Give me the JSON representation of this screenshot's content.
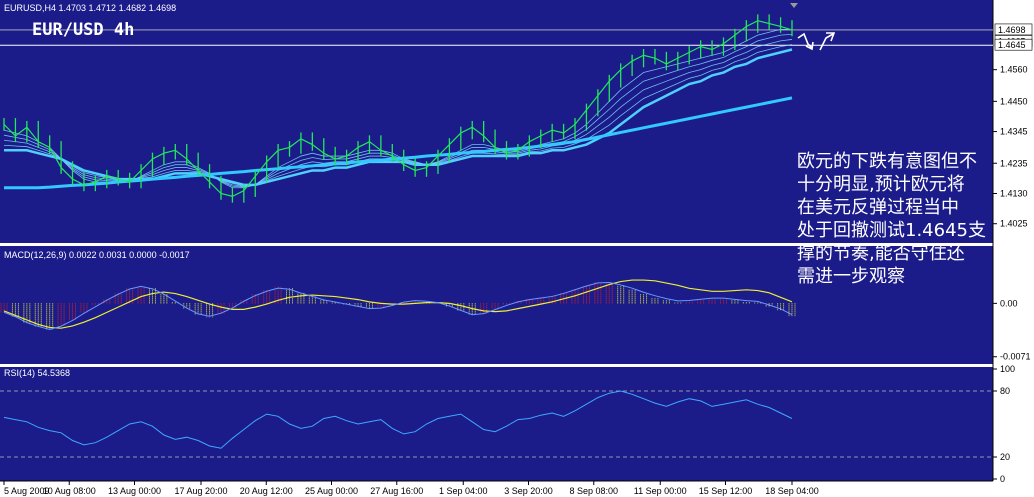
{
  "chart_data": [
    {
      "type": "line",
      "header": "EURUSD,H4  1.4703 1.4712 1.4682 1.4698",
      "title": "EUR/USD  4h",
      "ylim": [
        1.3965,
        1.4795
      ],
      "yticks": [
        "1.4560",
        "1.4450",
        "1.4345",
        "1.4235",
        "1.4130",
        "1.4025"
      ],
      "ytick_values": [
        1.456,
        1.445,
        1.4345,
        1.4235,
        1.413,
        1.4025
      ],
      "price_labels": [
        "1.4698",
        "1.4665",
        "1.4645"
      ],
      "price_label_values": [
        1.4698,
        1.4665,
        1.4645
      ],
      "support_level": 1.4645,
      "price": [
        1.437,
        1.433,
        1.436,
        1.431,
        1.429,
        1.422,
        1.418,
        1.416,
        1.417,
        1.419,
        1.418,
        1.417,
        1.421,
        1.425,
        1.427,
        1.428,
        1.425,
        1.421,
        1.417,
        1.413,
        1.412,
        1.414,
        1.419,
        1.424,
        1.428,
        1.429,
        1.432,
        1.43,
        1.427,
        1.425,
        1.426,
        1.429,
        1.431,
        1.428,
        1.426,
        1.423,
        1.421,
        1.422,
        1.426,
        1.43,
        1.434,
        1.436,
        1.433,
        1.429,
        1.427,
        1.428,
        1.431,
        1.433,
        1.435,
        1.434,
        1.437,
        1.442,
        1.447,
        1.452,
        1.456,
        1.459,
        1.461,
        1.46,
        1.458,
        1.46,
        1.462,
        1.464,
        1.463,
        1.465,
        1.468,
        1.471,
        1.473,
        1.472,
        1.471,
        1.4698
      ],
      "ma_fast": [
        1.435,
        1.434,
        1.433,
        1.431,
        1.429,
        1.425,
        1.421,
        1.418,
        1.417,
        1.417,
        1.417,
        1.417,
        1.419,
        1.421,
        1.423,
        1.424,
        1.424,
        1.422,
        1.42,
        1.417,
        1.415,
        1.415,
        1.416,
        1.419,
        1.422,
        1.424,
        1.426,
        1.427,
        1.426,
        1.426,
        1.426,
        1.427,
        1.428,
        1.428,
        1.427,
        1.425,
        1.424,
        1.423,
        1.424,
        1.426,
        1.428,
        1.43,
        1.43,
        1.429,
        1.428,
        1.428,
        1.429,
        1.43,
        1.431,
        1.432,
        1.434,
        1.437,
        1.441,
        1.445,
        1.449,
        1.452,
        1.455,
        1.456,
        1.457,
        1.458,
        1.459,
        1.46,
        1.461,
        1.462,
        1.464,
        1.466,
        1.468,
        1.469,
        1.47,
        1.47
      ],
      "ma_mid": [
        1.428,
        1.428,
        1.428,
        1.427,
        1.426,
        1.425,
        1.423,
        1.421,
        1.42,
        1.419,
        1.418,
        1.418,
        1.418,
        1.418,
        1.419,
        1.42,
        1.42,
        1.42,
        1.419,
        1.418,
        1.417,
        1.416,
        1.416,
        1.417,
        1.418,
        1.419,
        1.42,
        1.421,
        1.421,
        1.422,
        1.422,
        1.423,
        1.424,
        1.424,
        1.424,
        1.424,
        1.423,
        1.423,
        1.423,
        1.424,
        1.425,
        1.426,
        1.426,
        1.426,
        1.426,
        1.426,
        1.427,
        1.427,
        1.428,
        1.428,
        1.429,
        1.43,
        1.432,
        1.434,
        1.437,
        1.44,
        1.443,
        1.445,
        1.447,
        1.449,
        1.451,
        1.452,
        1.454,
        1.455,
        1.457,
        1.458,
        1.46,
        1.461,
        1.462,
        1.463
      ],
      "ma_slow": [
        1.415,
        1.415,
        1.415,
        1.415,
        1.4152,
        1.4155,
        1.4158,
        1.416,
        1.4163,
        1.4166,
        1.417,
        1.4173,
        1.4176,
        1.418,
        1.4183,
        1.4186,
        1.419,
        1.4193,
        1.4196,
        1.42,
        1.4203,
        1.4206,
        1.421,
        1.4213,
        1.4216,
        1.422,
        1.4223,
        1.4226,
        1.423,
        1.4233,
        1.4236,
        1.424,
        1.4243,
        1.4246,
        1.425,
        1.4253,
        1.4256,
        1.426,
        1.4263,
        1.4266,
        1.427,
        1.4273,
        1.4276,
        1.428,
        1.4283,
        1.4286,
        1.429,
        1.4295,
        1.43,
        1.4305,
        1.431,
        1.4318,
        1.4326,
        1.4334,
        1.4342,
        1.435,
        1.4358,
        1.4366,
        1.4374,
        1.4382,
        1.439,
        1.4398,
        1.4406,
        1.4414,
        1.4422,
        1.443,
        1.4438,
        1.4446,
        1.4454,
        1.4462
      ]
    },
    {
      "type": "bar",
      "header": "MACD(12,26,9) 0.0022 0.0031 0.0000 -0.0017",
      "ylim": [
        -0.0078,
        0.0055
      ],
      "yticks": [
        "0.00",
        "-0.0071"
      ],
      "ytick_values": [
        0,
        -0.0071
      ],
      "values": [
        -0.0012,
        -0.0018,
        -0.0026,
        -0.0031,
        -0.0035,
        -0.003,
        -0.0022,
        -0.0012,
        -0.0003,
        0.0006,
        0.0014,
        0.0021,
        0.0024,
        0.002,
        0.0012,
        0.0002,
        -0.0008,
        -0.0016,
        -0.0019,
        -0.0014,
        -0.0006,
        0.0004,
        0.0012,
        0.0018,
        0.0022,
        0.002,
        0.0014,
        0.0009,
        0.0004,
        0.0001,
        -0.0002,
        -0.0005,
        -0.0008,
        -0.0007,
        -0.0003,
        0.0002,
        0.0004,
        0.0003,
        0.0001,
        -0.0004,
        -0.001,
        -0.0016,
        -0.0014,
        -0.0008,
        -0.0002,
        0.0003,
        0.0006,
        0.0008,
        0.001,
        0.0014,
        0.0019,
        0.0024,
        0.0028,
        0.0028,
        0.0024,
        0.0019,
        0.0013,
        0.0008,
        0.0004,
        0.0001,
        0.0002,
        0.0004,
        0.0006,
        0.0006,
        0.0004,
        0.0002,
        0.0001,
        -0.0004,
        -0.0009,
        -0.0017
      ],
      "signal": [
        -0.001,
        -0.0016,
        -0.0022,
        -0.0028,
        -0.0032,
        -0.0033,
        -0.003,
        -0.0025,
        -0.0019,
        -0.0012,
        -0.0005,
        0.0002,
        0.0009,
        0.0013,
        0.0015,
        0.0013,
        0.0009,
        0.0004,
        -0.0001,
        -0.0005,
        -0.0008,
        -0.0008,
        -0.0005,
        -0.0001,
        0.0004,
        0.0008,
        0.001,
        0.0011,
        0.001,
        0.0009,
        0.0007,
        0.0005,
        0.0002,
        0.0,
        -0.0001,
        -0.0001,
        0.0,
        0.0001,
        0.0001,
        0.0,
        -0.0003,
        -0.0007,
        -0.001,
        -0.0011,
        -0.001,
        -0.0007,
        -0.0004,
        -0.0001,
        0.0002,
        0.0006,
        0.001,
        0.0015,
        0.002,
        0.0025,
        0.0029,
        0.0031,
        0.0031,
        0.003,
        0.0027,
        0.0024,
        0.002,
        0.0018,
        0.0016,
        0.0016,
        0.0017,
        0.0018,
        0.0017,
        0.0014,
        0.0008,
        0.0002
      ]
    },
    {
      "type": "line",
      "header": "RSI(14) 54.5368",
      "ylim": [
        0,
        100
      ],
      "yticks": [
        "100",
        "80",
        "20",
        "0"
      ],
      "ytick_values": [
        100,
        80,
        20,
        0
      ],
      "levels": [
        80,
        20
      ],
      "values": [
        56,
        54,
        52,
        47,
        44,
        42,
        35,
        31,
        33,
        38,
        44,
        50,
        52,
        48,
        40,
        36,
        38,
        35,
        30,
        28,
        37,
        45,
        53,
        59,
        57,
        50,
        46,
        48,
        55,
        57,
        53,
        50,
        52,
        54,
        46,
        41,
        43,
        50,
        55,
        57,
        59,
        52,
        45,
        43,
        48,
        54,
        55,
        58,
        60,
        57,
        62,
        68,
        74,
        78,
        80,
        77,
        73,
        69,
        66,
        70,
        73,
        71,
        66,
        68,
        70,
        72,
        68,
        65,
        60,
        55
      ]
    }
  ],
  "xaxis": {
    "labels": [
      "5 Aug 2009",
      "10 Aug 08:00",
      "13 Aug 00:00",
      "17 Aug 20:00",
      "20 Aug 12:00",
      "25 Aug 00:00",
      "27 Aug 16:00",
      "1 Sep 04:00",
      "3 Sep 20:00",
      "8 Sep 08:00",
      "11 Sep 00:00",
      "15 Sep 12:00",
      "18 Sep 04:00"
    ],
    "positions": [
      0,
      5.3,
      10.6,
      16.0,
      21.3,
      26.6,
      31.9,
      37.3,
      42.6,
      47.9,
      53.3,
      58.6,
      64.0
    ]
  },
  "comment": [
    "欧元的下跌有意图但不",
    "十分明显,预计欧元将",
    "在美元反弹过程当中",
    "处于回撤测试1.4645支",
    "撑的节奏,能否守住还",
    "需进一步观察"
  ],
  "colors": {
    "background": "#1b1b8a",
    "price": "#22e85c",
    "ma_fast": "#4fd0ff",
    "ma_slow": "#33c8ff",
    "macd_up": "#dd2222",
    "macd_down": "#eeee33",
    "signal": "#eeee33",
    "macd_line": "#6699ff",
    "rsi": "#3fa9ff"
  }
}
